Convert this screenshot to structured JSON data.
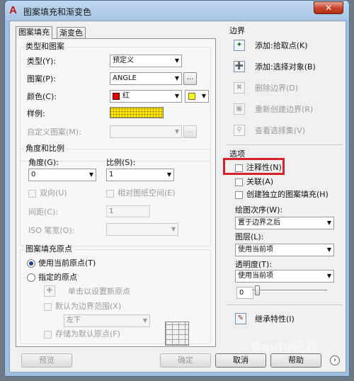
{
  "window": {
    "title": "图案填充和渐变色",
    "close_glyph": "✕"
  },
  "tabs": [
    {
      "label": "图案填充",
      "active": true
    },
    {
      "label": "渐变色",
      "active": false
    }
  ],
  "type_pattern": {
    "group_title": "类型和图案",
    "type_label": "类型(Y):",
    "type_value": "预定义",
    "pattern_label": "图案(P):",
    "pattern_value": "ANGLE",
    "color_label": "颜色(C):",
    "color_value": "红",
    "sample_label": "样例:",
    "custom_label": "自定义图案(M):",
    "ellipsis": "...",
    "colors": {
      "hatch": "#e00000",
      "background": "#ffff00",
      "sample": "#ffee00"
    }
  },
  "angle_scale": {
    "group_title": "角度和比例",
    "angle_label": "角度(G):",
    "angle_value": "0",
    "scale_label": "比例(S):",
    "scale_value": "1",
    "double_label": "双向(U)",
    "relative_label": "相对图纸空间(E)",
    "spacing_label": "间距(C):",
    "spacing_value": "1",
    "iso_label": "ISO 笔宽(O):"
  },
  "origin": {
    "group_title": "图案填充原点",
    "use_current_label": "使用当前原点(T)",
    "specified_label": "指定的原点",
    "click_set_label": "单击以设置新原点",
    "default_extent_label": "默认为边界范围(X)",
    "extent_value": "左下",
    "store_default_label": "存储为默认原点(F)"
  },
  "boundaries": {
    "group_title": "边界",
    "add_pick_label": "添加:拾取点(K)",
    "add_select_label": "添加:选择对象(B)",
    "remove_label": "删除边界(D)",
    "recreate_label": "重新创建边界(R)",
    "view_selection_label": "查看选择集(V)"
  },
  "options": {
    "group_title": "选项",
    "annotative_label": "注释性(N)",
    "associative_label": "关联(A)",
    "separate_label": "创建独立的图案填充(H)",
    "draw_order_label": "绘图次序(W):",
    "draw_order_value": "置于边界之后",
    "layer_label": "图层(L):",
    "layer_value": "使用当前项",
    "transparency_label": "透明度(T):",
    "transparency_value": "使用当前项",
    "transparency_number": "0",
    "inherit_label": "继承特性(I)"
  },
  "buttons": {
    "preview": "预览",
    "ok": "确定",
    "cancel": "取消",
    "help": "帮助"
  },
  "watermark": "Baidu经验"
}
